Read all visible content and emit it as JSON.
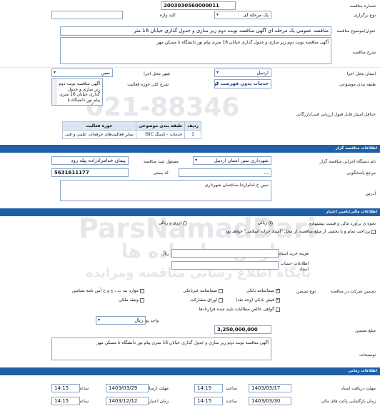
{
  "header": {
    "tender_number_label": "شماره مناقصه",
    "tender_number_value": "2003030560000011",
    "holding_type_label": "نوع برگزاری",
    "holding_type_value": "یک مرحله ای",
    "keyword_label": "کلید واژه",
    "title_label": "عنوان/موضوع مناقصه",
    "title_value": "مناقصه عمومی یک مرحله ای آگهی مناقصه نوبت دوم زیر سازی و جدول گذاری خیابان 16 متر",
    "description_label": "شرح مناقصه",
    "description_value": "آگهی مناقصه نوبت دوم زیر سازی و جدول گذاری خیابان 16 متری پیام نور دانشگاه تا مسکن مهر"
  },
  "location": {
    "province_label": "استان محل اجرا",
    "province_value": "اردبیل",
    "city_label": "شهر محل اجرا",
    "city_value": "نمین",
    "category_label": "طبقه بندی موضوعی",
    "category_value": "خدمات بدون فهرست بها",
    "activity_label": "شرح کلی حوزه فعالیت",
    "activity_value": "آگهی مناقصه نوبت دوم زیر سازی و جدول گذاری خیابان 16 متری پیام نور دانشگاه تا مسکن مهر",
    "min_score_label": "حداقل امتیاز قابل قبول ارزیابی فنی/بازرگانی"
  },
  "category_table": {
    "headers": [
      "ردیف",
      "طبقه بندی موضوعی",
      "حوزه فعالیت"
    ],
    "rows": [
      [
        "1",
        "خدمات - کدینگ ISIC",
        "سایر فعالیت‌های حرفه‌ای، علمی و فنی"
      ]
    ]
  },
  "organizer": {
    "section_title": "اطلاعات مناقصه گزار",
    "agency_label": "نام دستگاه اجرایی مناقصه گزار",
    "agency_value": "شهرداری نمین استان اردبیل",
    "responsible_label": "مسئول ثبت مناقصه",
    "responsible_value": "پیمان خدامرادزاده پیله رود",
    "reference_label": "مرجع پاسخگویی",
    "reference_value": "...",
    "postal_label": "کد پستی",
    "postal_value": "5631611177",
    "address_label": "آدرس",
    "address_value": "نمین خ امام(ره) ساختمان شهرداری"
  },
  "financial": {
    "section_title": "اطلاعات مالی/تامین اعتبار",
    "estimate_label": "نحوه ی برآورد مالی و قیمت پیشنهادی",
    "estimate_options": [
      "ریالی",
      "ارزی و ریالی"
    ],
    "payment_text": "پرداخت تمام و یا بخشی از مبلغ مناقصه، از محل \"اسناد خزانه اسلامی\" خواهد بود",
    "doc_fee_label": "هزینه خرید اسناد",
    "doc_fee_unit": "ریال",
    "account_label": "اطلاعات حساب جهت واریز هزینه خرید اسناد",
    "guarantee_type_label": "تضمین شرکت در مناقصه",
    "guarantee_kind_label": "نوع تضمین",
    "guarantee_options": [
      "ضمانتنامه بانکی",
      "ضمانتنامه غیربانکی",
      "موارد بند ب ، ج و ح آیین نامه تضامین",
      "فیش بانکی (وجه نقد)",
      "اوراق مشارکت",
      "وثیقه ملکی",
      "گواهی خالص مطالبات تایید شده قراردادها"
    ],
    "currency_label": "واحد پول",
    "currency_value": "ریال",
    "guarantee_amount_label": "مبلغ تضمین",
    "guarantee_amount_value": "3,250,000,000",
    "notes_label": "توضیحات",
    "notes_value": "آگهی مناقصه نوبت دوم زیر سازی و جدول گذاری خیابان 16 متری پیام نور دانشگاه تا مسکن مهر"
  },
  "timing": {
    "section_title": "اطلاعات زمانی",
    "doc_receive_deadline_label": "مهلت دریافت اسناد",
    "doc_receive_deadline_date": "1403/03/17",
    "doc_receive_deadline_time": "14:15",
    "bid_submission_label": "مهلت ارسال پاکتهای پیشنهاد",
    "bid_submission_date": "1403/03/29",
    "bid_submission_time": "14:15",
    "opening_label": "زمان بازگشایی پاکت های مالی",
    "opening_date": "1403/03/30",
    "opening_time": "14:15",
    "validity_label": "زمان اعتبار پیشنهاد",
    "validity_date": "1403/12/12",
    "validity_time": "14:15",
    "time_label": "ساعت"
  },
  "watermark": {
    "text_latin": "ParsNamadDari",
    "text_fa": "پارس نماد داده ها",
    "text_fa2": "پایگاه اطلاع رسانی مناقصه ومزایده",
    "phone": "021-88346"
  },
  "colors": {
    "section_bar": "#1f5fa6",
    "field_border": "#8aa3c4",
    "table_header": "#dbe6f4"
  }
}
